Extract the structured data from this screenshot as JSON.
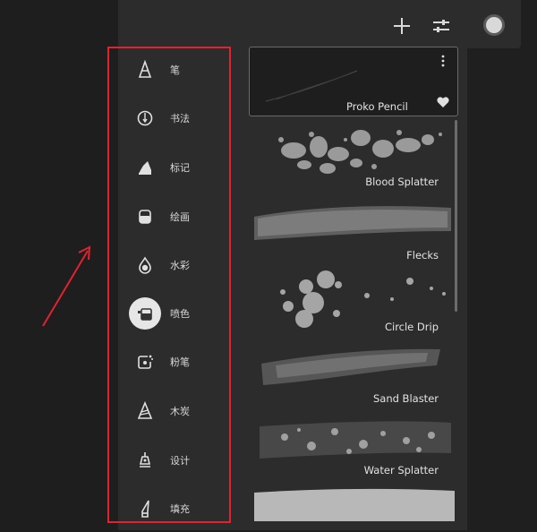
{
  "categories": [
    {
      "label": "笔",
      "icon": "pencil-cone-icon"
    },
    {
      "label": "书法",
      "icon": "calligraphy-nib-icon"
    },
    {
      "label": "标记",
      "icon": "marker-icon"
    },
    {
      "label": "绘画",
      "icon": "paint-jar-icon"
    },
    {
      "label": "水彩",
      "icon": "water-drop-icon"
    },
    {
      "label": "喷色",
      "icon": "spray-can-icon",
      "active": true
    },
    {
      "label": "粉笔",
      "icon": "chalk-icon"
    },
    {
      "label": "木炭",
      "icon": "charcoal-icon"
    },
    {
      "label": "设计",
      "icon": "design-pen-icon"
    },
    {
      "label": "填充",
      "icon": "fill-brush-icon"
    }
  ],
  "brushes": [
    {
      "name": "Proko Pencil",
      "selected": true
    },
    {
      "name": "Blood Splatter"
    },
    {
      "name": "Flecks"
    },
    {
      "name": "Circle Drip"
    },
    {
      "name": "Sand Blaster"
    },
    {
      "name": "Water Splatter"
    },
    {
      "name": ""
    }
  ],
  "colors": {
    "panel": "#2c2c2d",
    "background": "#1f1f1f",
    "highlight_frame": "#e0232e",
    "active_color": "#d9d9d9"
  },
  "toolbar": {
    "add_icon": "plus-icon",
    "settings_icon": "sliders-icon",
    "color_icon": "color-swatch-icon"
  }
}
